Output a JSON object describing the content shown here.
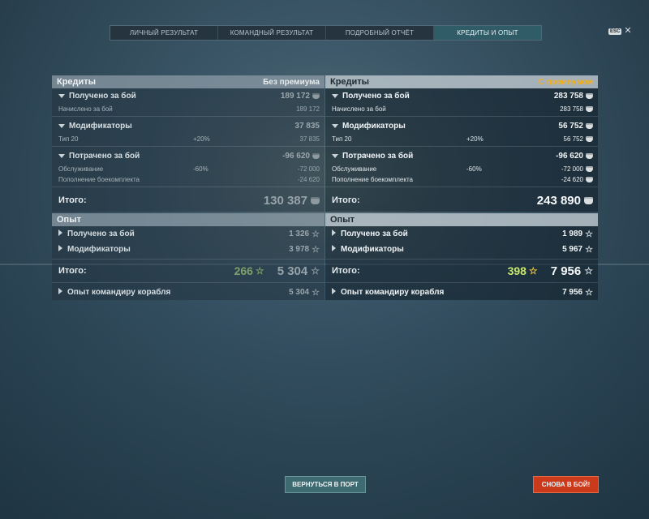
{
  "tabs": [
    {
      "label": "ЛИЧНЫЙ РЕЗУЛЬТАТ",
      "active": false
    },
    {
      "label": "КОМАНДНЫЙ РЕЗУЛЬТАТ",
      "active": false
    },
    {
      "label": "ПОДРОБНЫЙ ОТЧЁТ",
      "active": false
    },
    {
      "label": "КРЕДИТЫ И ОПЫТ",
      "active": true
    }
  ],
  "esc": {
    "key_label": "ESC",
    "close_glyph": "✕"
  },
  "left": {
    "credits_title": "Кредиты",
    "tag": "Без премиума",
    "earned": {
      "label": "Получено за бой",
      "value": "189 172"
    },
    "earned_detail": {
      "label": "Начислено за бой",
      "value": "189 172"
    },
    "modifiers": {
      "label": "Модификаторы",
      "value": "37 835"
    },
    "modifiers_detail": {
      "label": "Тип 20",
      "pct": "+20%",
      "value": "37 835"
    },
    "spent": {
      "label": "Потрачено за бой",
      "value": "-96 620"
    },
    "service": {
      "label": "Обслуживание",
      "pct": "-60%",
      "value": "-72 000"
    },
    "ammo": {
      "label": "Пополнение боекомплекта",
      "value": "-24 620"
    },
    "credits_total": {
      "label": "Итого:",
      "value": "130 387"
    },
    "xp_title": "Опыт",
    "xp_earned": {
      "label": "Получено за бой",
      "value": "1 326"
    },
    "xp_modifiers": {
      "label": "Модификаторы",
      "value": "3 978"
    },
    "xp_total": {
      "label": "Итого:",
      "free": "266",
      "value": "5 304"
    },
    "commander": {
      "label": "Опыт командиру корабля",
      "value": "5 304"
    }
  },
  "right": {
    "credits_title": "Кредиты",
    "tag": "С премиумом",
    "earned": {
      "label": "Получено за бой",
      "value": "283 758"
    },
    "earned_detail": {
      "label": "Начислено за бой",
      "value": "283 758"
    },
    "modifiers": {
      "label": "Модификаторы",
      "value": "56 752"
    },
    "modifiers_detail": {
      "label": "Тип 20",
      "pct": "+20%",
      "value": "56 752"
    },
    "spent": {
      "label": "Потрачено за бой",
      "value": "-96 620"
    },
    "service": {
      "label": "Обслуживание",
      "pct": "-60%",
      "value": "-72 000"
    },
    "ammo": {
      "label": "Пополнение боекомплекта",
      "value": "-24 620"
    },
    "credits_total": {
      "label": "Итого:",
      "value": "243 890"
    },
    "xp_title": "Опыт",
    "xp_earned": {
      "label": "Получено за бой",
      "value": "1 989"
    },
    "xp_modifiers": {
      "label": "Модификаторы",
      "value": "5 967"
    },
    "xp_total": {
      "label": "Итого:",
      "free": "398",
      "value": "7 956"
    },
    "commander": {
      "label": "Опыт командиру корабля",
      "value": "7 956"
    }
  },
  "buttons": {
    "port": "ВЕРНУТЬСЯ В ПОРТ",
    "battle": "СНОВА В БОЙ!"
  },
  "icons": {
    "credits": "credits-icon",
    "xp": "star-icon"
  },
  "colors": {
    "premium_tag": "#f2b01e",
    "free_xp": "#c8e86f",
    "battle_button": "#cc3a1c",
    "active_tab": "#2f5c66"
  }
}
